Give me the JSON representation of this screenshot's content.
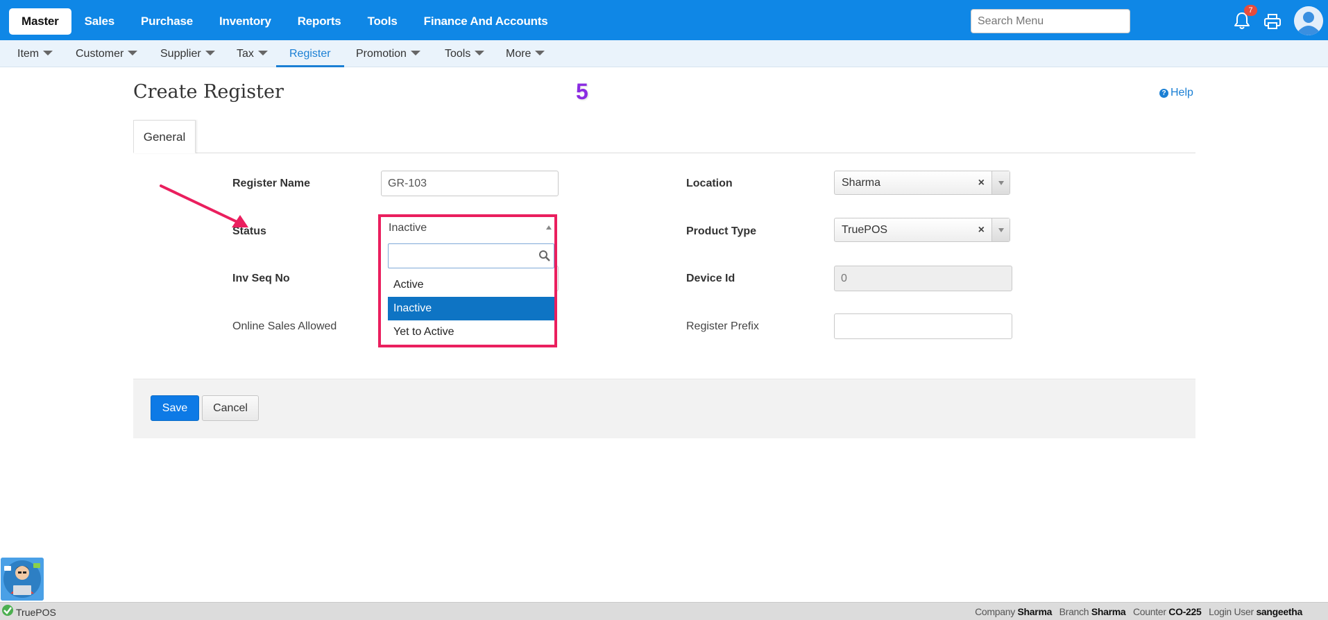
{
  "topnav": {
    "items": [
      "Master",
      "Sales",
      "Purchase",
      "Inventory",
      "Reports",
      "Tools",
      "Finance And Accounts"
    ],
    "active": "Master"
  },
  "search": {
    "placeholder": "Search Menu"
  },
  "notifications": {
    "count": "7"
  },
  "subnav": {
    "items": [
      "Item",
      "Customer",
      "Supplier",
      "Tax",
      "Register",
      "Promotion",
      "Tools",
      "More"
    ],
    "active": "Register"
  },
  "page": {
    "title": "Create Register",
    "step_marker": "5",
    "help": "Help",
    "tab": "General"
  },
  "form": {
    "register_name": {
      "label": "Register Name",
      "value": "GR-103"
    },
    "status": {
      "label": "Status",
      "value": "Inactive",
      "search_value": "",
      "options": [
        "Active",
        "Inactive",
        "Yet to Active"
      ],
      "selected": "Inactive"
    },
    "inv_seq_no": {
      "label": "Inv Seq No"
    },
    "online_sales": {
      "label": "Online Sales Allowed"
    },
    "location": {
      "label": "Location",
      "value": "Sharma"
    },
    "product_type": {
      "label": "Product Type",
      "value": "TruePOS"
    },
    "device_id": {
      "label": "Device Id",
      "value": "0"
    },
    "register_prefix": {
      "label": "Register Prefix",
      "value": ""
    }
  },
  "actions": {
    "save": "Save",
    "cancel": "Cancel"
  },
  "statusbar": {
    "app": "TruePOS",
    "company_label": "Company",
    "company": "Sharma",
    "branch_label": "Branch",
    "branch": "Sharma",
    "counter_label": "Counter",
    "counter": "CO-225",
    "user_label": "Login User",
    "user": "sangeetha"
  },
  "colors": {
    "topbar": "#0f87e6",
    "accent": "#1a7fd4",
    "highlight_box": "#ea1f5e",
    "selected_option": "#0e74c4",
    "save_button": "#0d7ae6",
    "step_marker": "#8a2be2"
  }
}
